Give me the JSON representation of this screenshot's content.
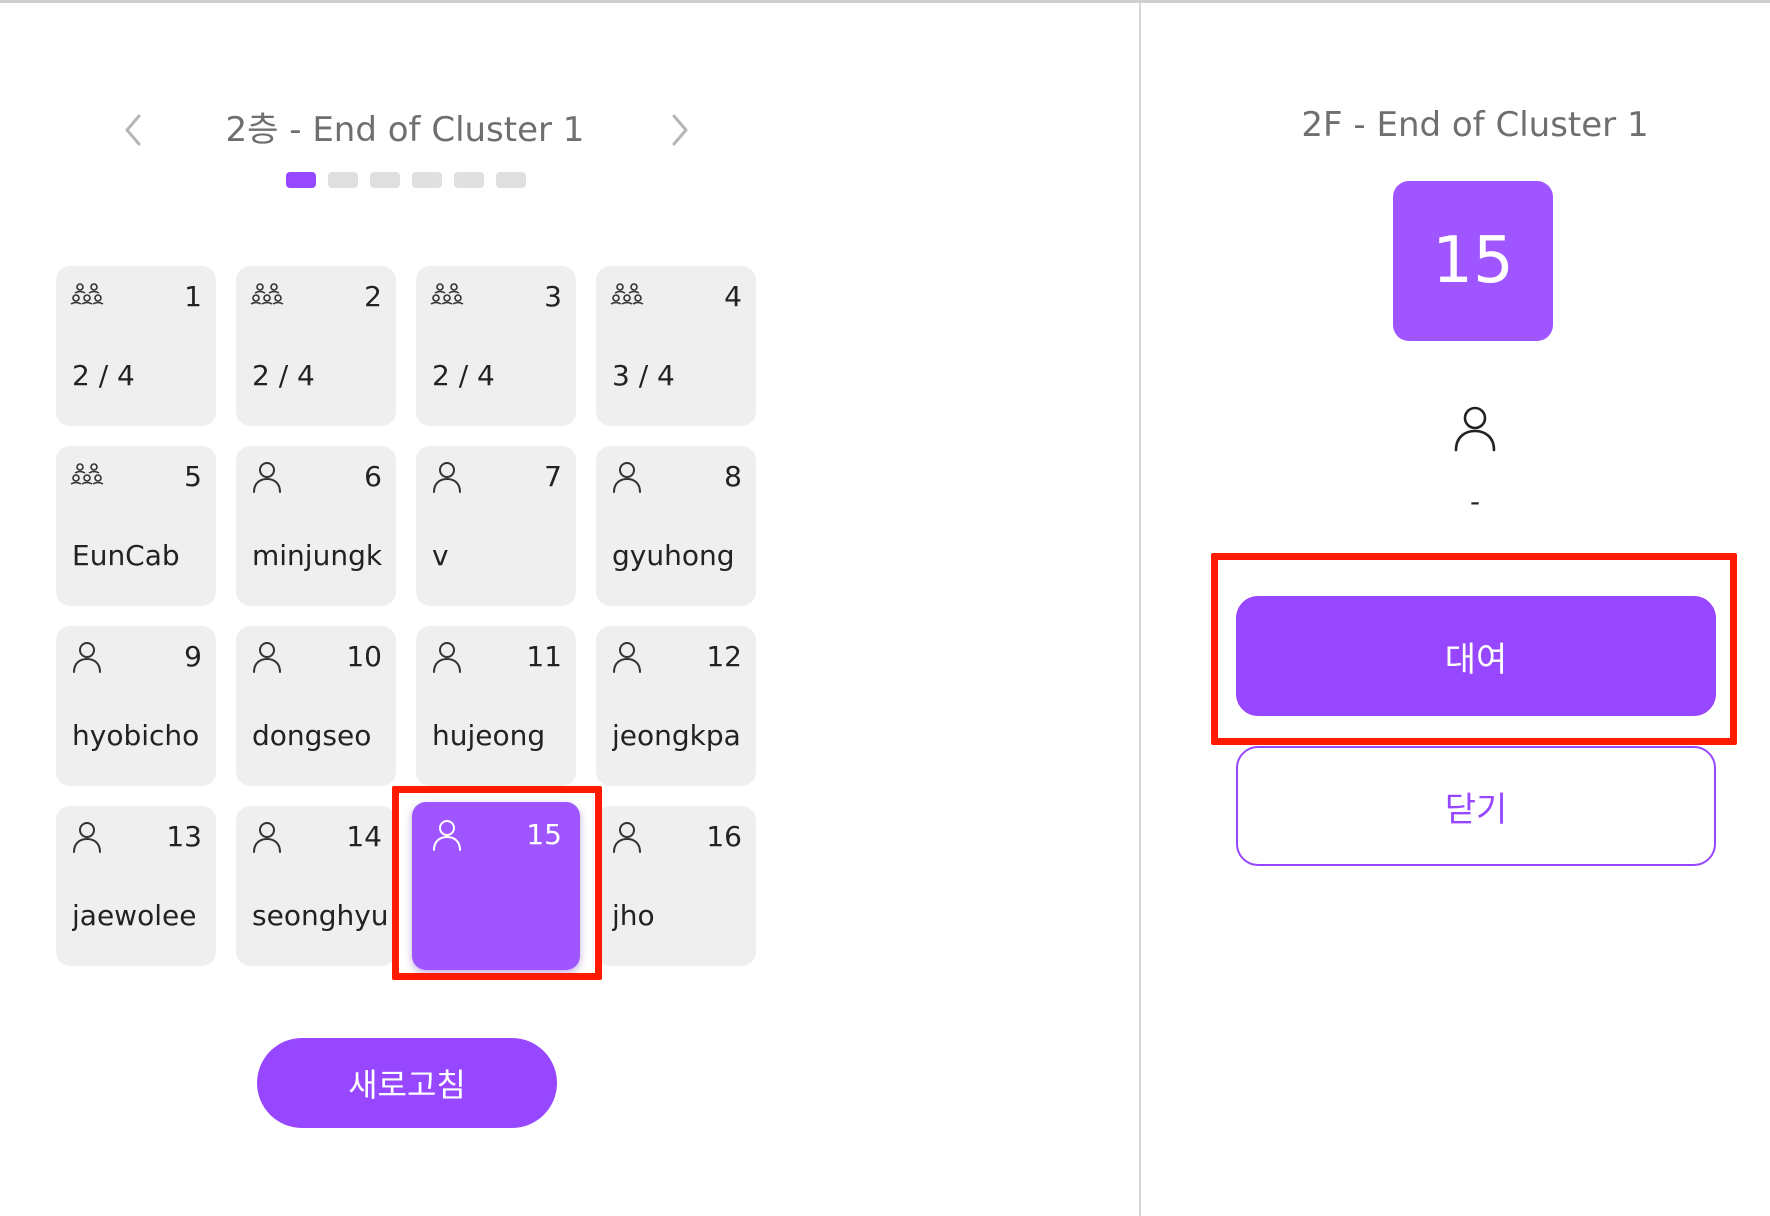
{
  "left_panel": {
    "title": "2층 - End of Cluster 1",
    "pagination": {
      "total": 6,
      "active": 1
    },
    "refresh_label": "새로고침",
    "seats": [
      {
        "num": "1",
        "icon": "group-icon",
        "text": "2 / 4",
        "selected": false
      },
      {
        "num": "2",
        "icon": "group-icon",
        "text": "2 / 4",
        "selected": false
      },
      {
        "num": "3",
        "icon": "group-icon",
        "text": "2 / 4",
        "selected": false
      },
      {
        "num": "4",
        "icon": "group-icon",
        "text": "3 / 4",
        "selected": false
      },
      {
        "num": "5",
        "icon": "group-icon",
        "text": "EunCab",
        "selected": false
      },
      {
        "num": "6",
        "icon": "person-icon",
        "text": "minjungk",
        "selected": false
      },
      {
        "num": "7",
        "icon": "person-icon",
        "text": "v",
        "selected": false
      },
      {
        "num": "8",
        "icon": "person-icon",
        "text": "gyuhong",
        "selected": false
      },
      {
        "num": "9",
        "icon": "person-icon",
        "text": "hyobicho",
        "selected": false
      },
      {
        "num": "10",
        "icon": "person-icon",
        "text": "dongseo",
        "selected": false
      },
      {
        "num": "11",
        "icon": "person-icon",
        "text": "hujeong",
        "selected": false
      },
      {
        "num": "12",
        "icon": "person-icon",
        "text": "jeongkpa",
        "selected": false
      },
      {
        "num": "13",
        "icon": "person-icon",
        "text": "jaewolee",
        "selected": false
      },
      {
        "num": "14",
        "icon": "person-icon",
        "text": "seonghyu",
        "selected": false
      },
      {
        "num": "15",
        "icon": "person-icon",
        "text": "",
        "selected": true
      },
      {
        "num": "16",
        "icon": "person-icon",
        "text": "jho",
        "selected": false
      }
    ]
  },
  "detail_panel": {
    "title": "2F - End of Cluster 1",
    "seat_number": "15",
    "user_icon": "person-icon",
    "user": "-",
    "rent_label": "대여",
    "close_label": "닫기"
  },
  "colors": {
    "accent": "#9747ff",
    "selected_tile": "#9f55ff",
    "tile_bg": "#efefef",
    "highlight": "#ff1a00"
  }
}
